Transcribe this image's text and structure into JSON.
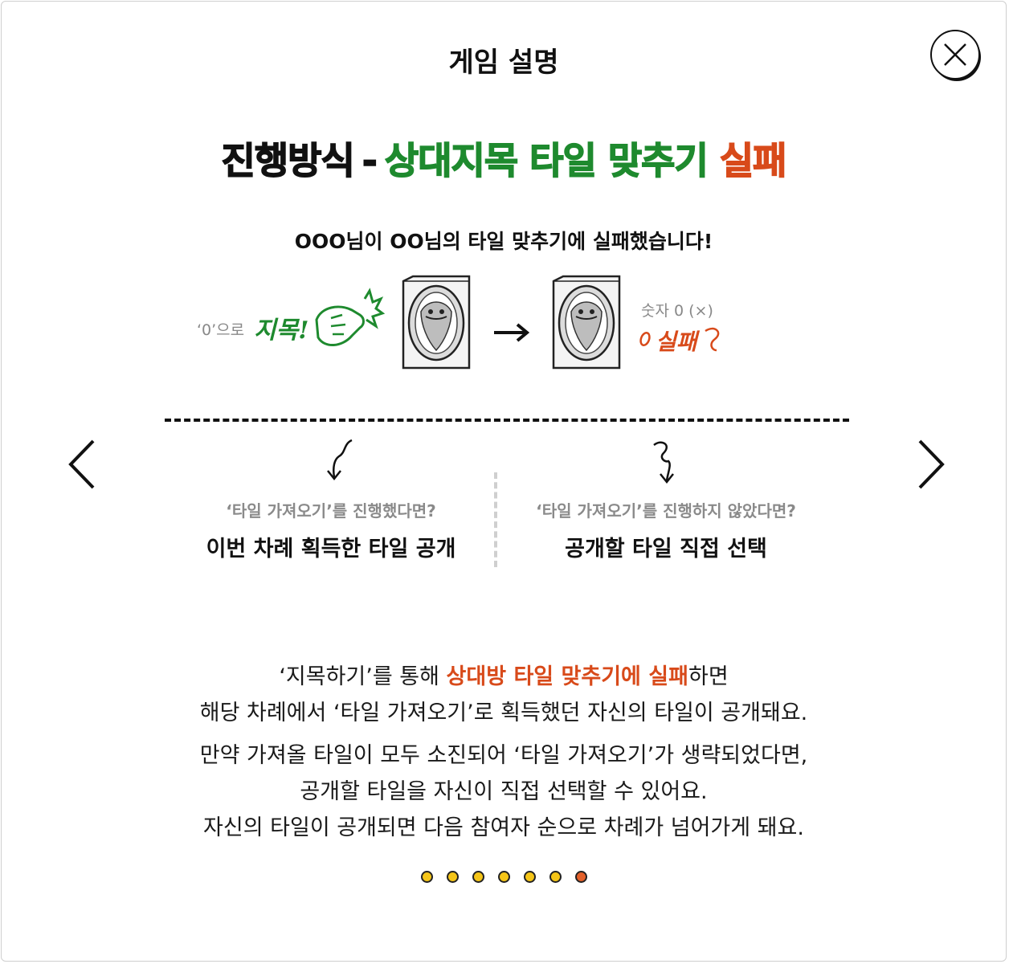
{
  "modal": {
    "title": "게임 설명",
    "close_icon": "close-icon"
  },
  "heading": {
    "black": "진행방식",
    "dash": "-",
    "green": "상대지목 타일 맞추기",
    "red": "실패"
  },
  "subtitle": "OOO님이 OO님의 타일 맞추기에 실패했습니다!",
  "illustration": {
    "left_note": "‘0’으로",
    "left_hand": "지목!",
    "right_note": "숫자 0 (×)",
    "right_hand": "실패",
    "arrow_icon": "arrow-right-icon",
    "card_icon": "tile-card-back-icon",
    "hand_icon": "pointing-hand-icon"
  },
  "left_col": {
    "question": "‘타일 가져오기’를 진행했다면?",
    "answer": "이번 차례 획득한 타일 공개"
  },
  "right_col": {
    "question": "‘타일 가져오기’를 진행하지 않았다면?",
    "answer": "공개할 타일 직접 선택"
  },
  "description": {
    "line1_pre": "‘지목하기’를 통해 ",
    "line1_hl": "상대방 타일 맞추기에 실패",
    "line1_post": "하면",
    "line2": "해당 차례에서 ‘타일 가져오기’로 획득했던 자신의 타일이 공개돼요.",
    "line3": "만약 가져올 타일이 모두 소진되어 ‘타일 가져오기’가 생략되었다면,",
    "line4": "공개할 타일을 자신이 직접 선택할 수 있어요.",
    "line5": "자신의 타일이 공개되면 다음 참여자 순으로 차례가 넘어가게 돼요."
  },
  "pagination": {
    "total": 7,
    "current": 7
  },
  "colors": {
    "green": "#1e8a2e",
    "red": "#d84a1a",
    "dot": "#f5c518",
    "dot_active": "#e3602a"
  }
}
